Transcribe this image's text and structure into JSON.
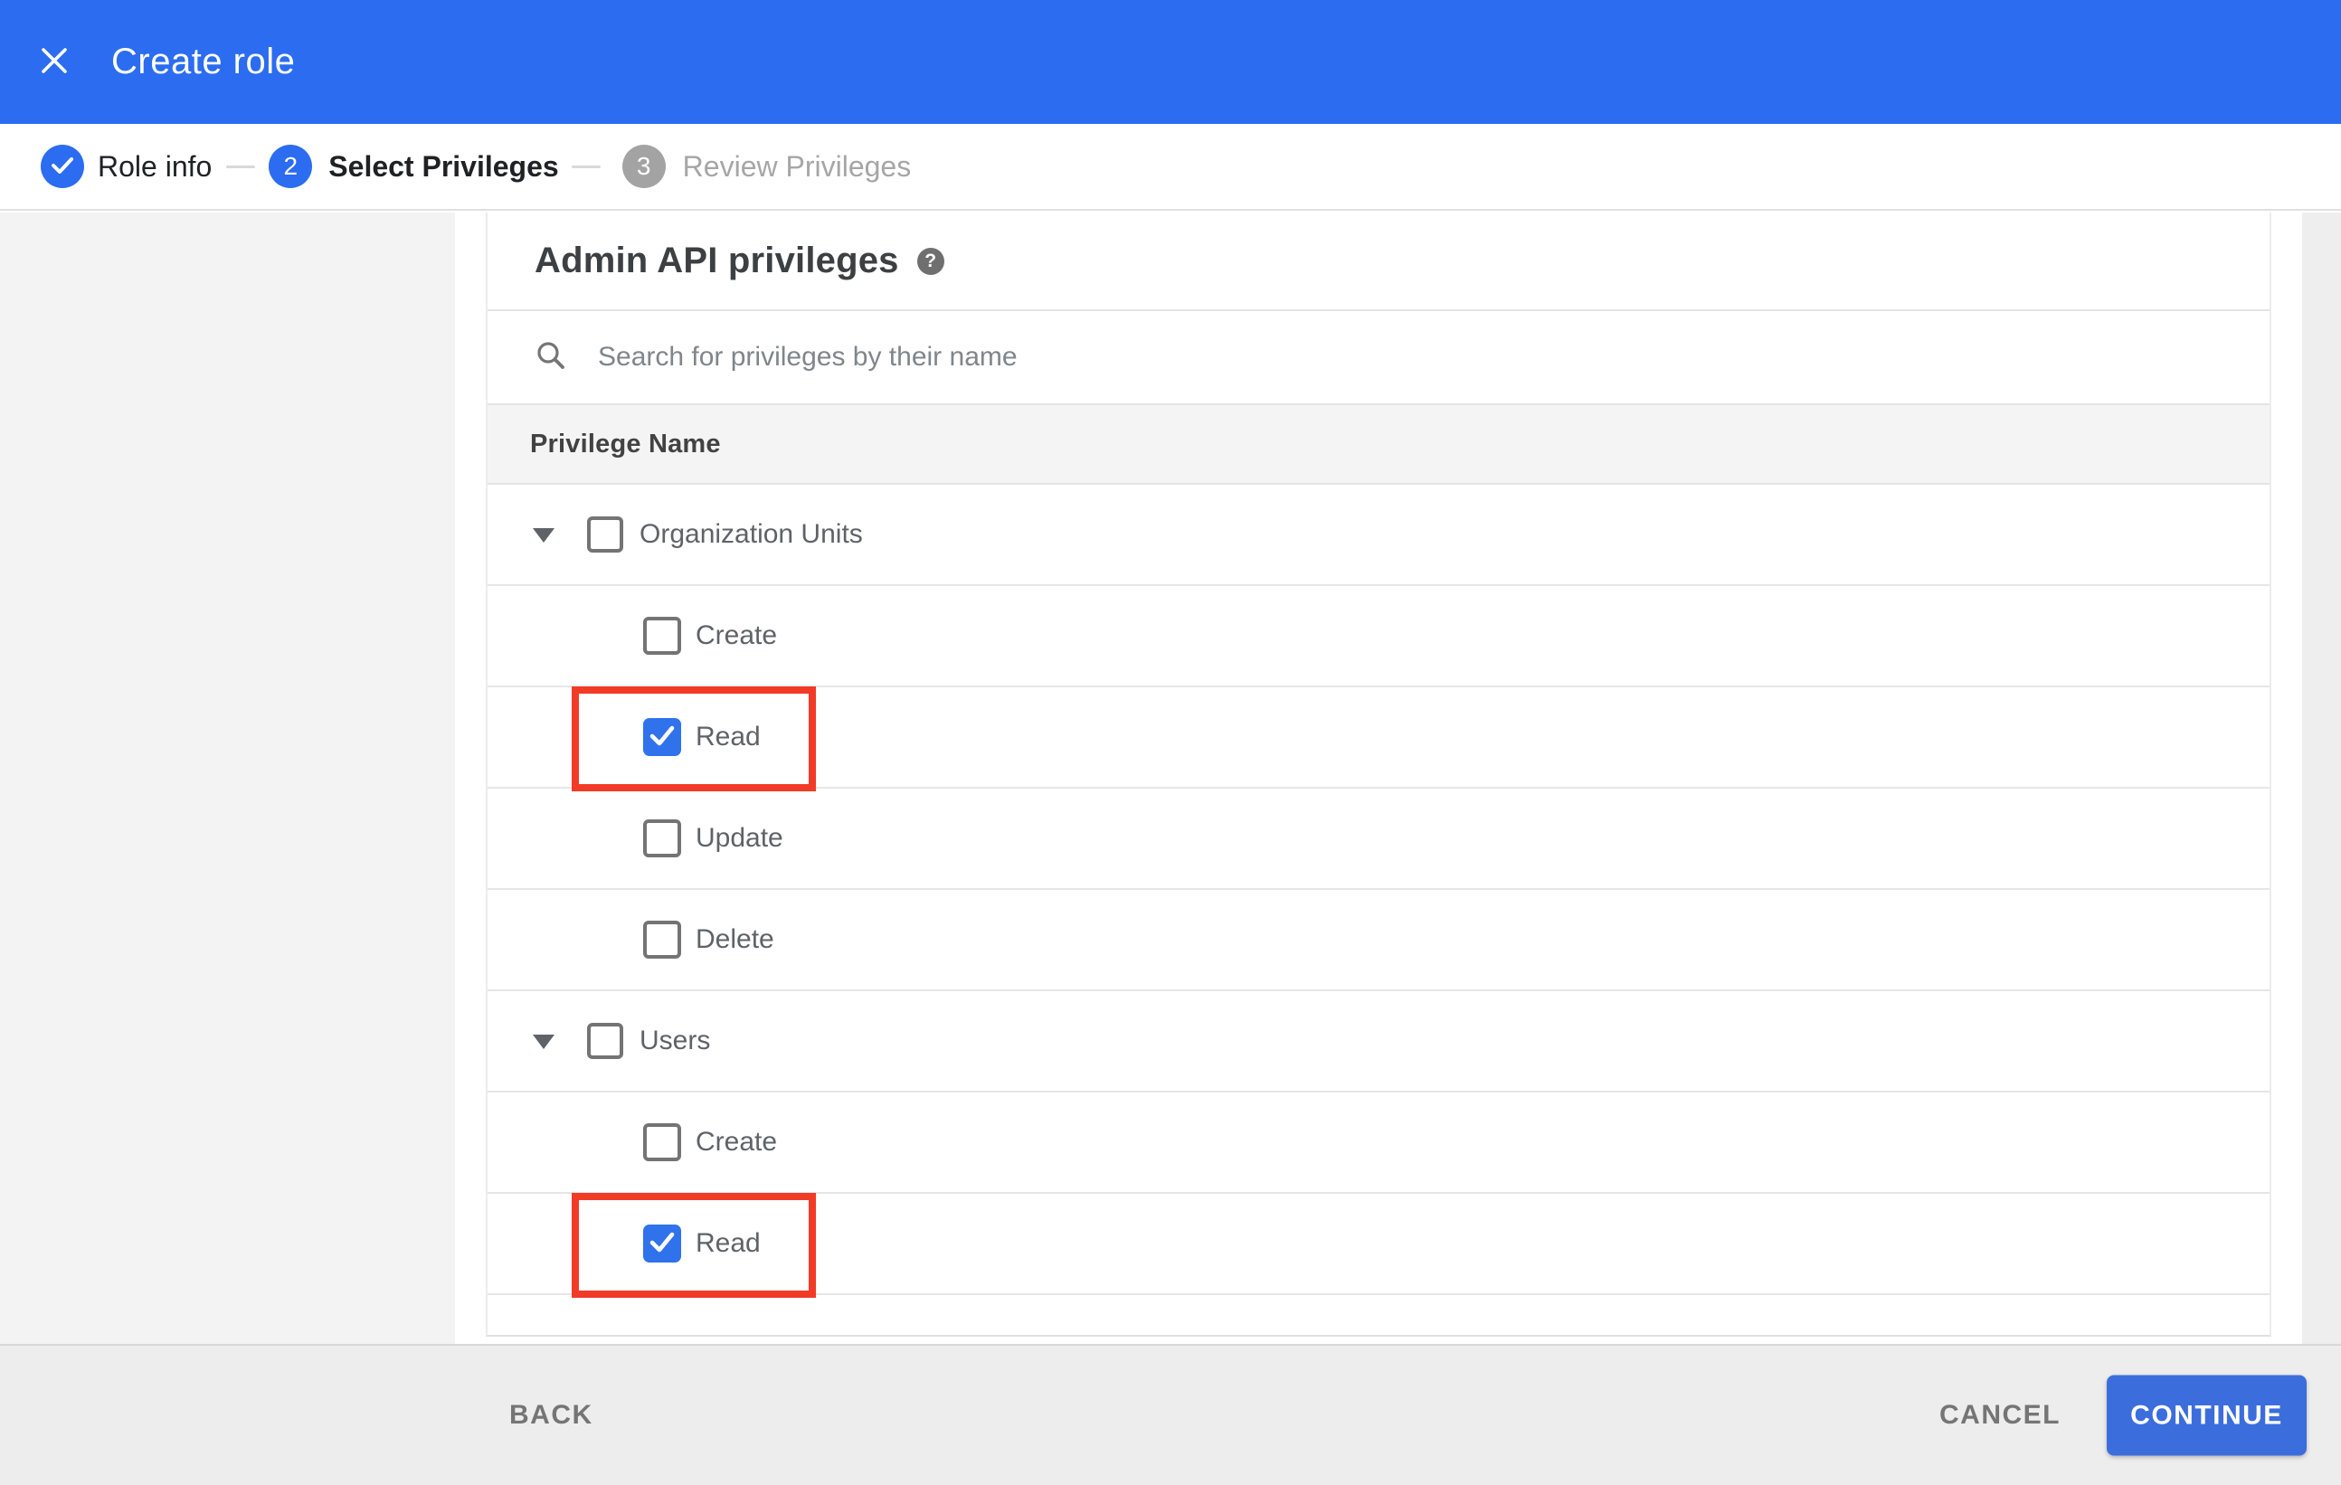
{
  "header": {
    "title": "Create role"
  },
  "stepper": {
    "step1_label": "Role info",
    "step2_number": "2",
    "step2_label": "Select Privileges",
    "step3_number": "3",
    "step3_label": "Review Privileges"
  },
  "content": {
    "section_title": "Admin API privileges",
    "help_icon": "?",
    "search_placeholder": "Search for privileges by their name",
    "table": {
      "header": "Privilege Name",
      "rows": [
        {
          "label": "Organization Units",
          "level": "group",
          "checked": false,
          "expanded": true
        },
        {
          "label": "Create",
          "level": "child",
          "checked": false
        },
        {
          "label": "Read",
          "level": "child",
          "checked": true,
          "highlighted": true
        },
        {
          "label": "Update",
          "level": "child",
          "checked": false
        },
        {
          "label": "Delete",
          "level": "child",
          "checked": false
        },
        {
          "label": "Users",
          "level": "group",
          "checked": false,
          "expanded": true
        },
        {
          "label": "Create",
          "level": "child",
          "checked": false
        },
        {
          "label": "Read",
          "level": "child",
          "checked": true,
          "highlighted": true
        }
      ]
    }
  },
  "footer": {
    "back": "BACK",
    "cancel": "CANCEL",
    "continue": "CONTINUE"
  },
  "colors": {
    "primary_blue": "#2b6cf0",
    "checkbox_blue": "#2f72ec",
    "continue_blue": "#3b6ddd",
    "highlight_red": "#f23b27"
  }
}
